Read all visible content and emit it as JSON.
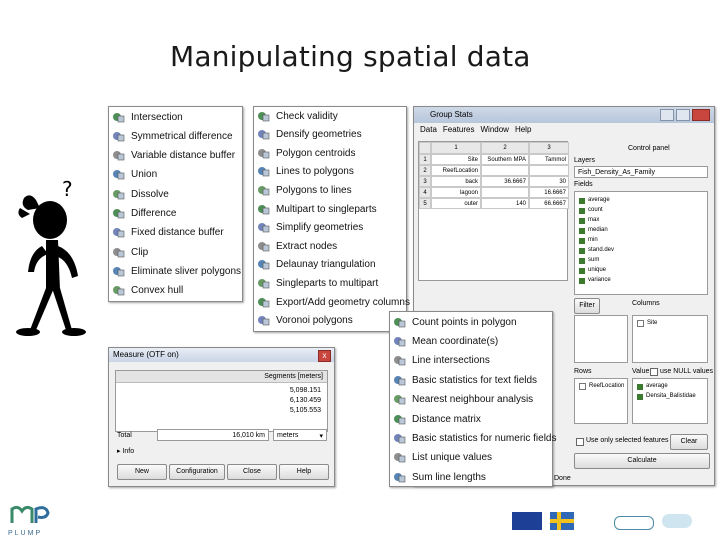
{
  "title": "Manipulating spatial data",
  "menu1": [
    {
      "label": "Intersection",
      "icon": "intersection-icon"
    },
    {
      "label": "Symmetrical difference",
      "icon": "symmetrical-difference-icon"
    },
    {
      "label": "Variable distance buffer",
      "icon": "variable-buffer-icon"
    },
    {
      "label": "Union",
      "icon": "union-icon"
    },
    {
      "label": "Dissolve",
      "icon": "dissolve-icon"
    },
    {
      "label": "Difference",
      "icon": "difference-icon"
    },
    {
      "label": "Fixed distance buffer",
      "icon": "fixed-buffer-icon"
    },
    {
      "label": "Clip",
      "icon": "clip-icon"
    },
    {
      "label": "Eliminate sliver polygons",
      "icon": "eliminate-sliver-icon"
    },
    {
      "label": "Convex hull",
      "icon": "convex-hull-icon"
    }
  ],
  "menu2": [
    {
      "label": "Check validity",
      "icon": "check-validity-icon"
    },
    {
      "label": "Densify geometries",
      "icon": "densify-icon"
    },
    {
      "label": "Polygon centroids",
      "icon": "centroids-icon"
    },
    {
      "label": "Lines to polygons",
      "icon": "lines-to-polygons-icon"
    },
    {
      "label": "Polygons to lines",
      "icon": "polygons-to-lines-icon"
    },
    {
      "label": "Multipart to singleparts",
      "icon": "multipart-icon"
    },
    {
      "label": "Simplify geometries",
      "icon": "simplify-icon"
    },
    {
      "label": "Extract nodes",
      "icon": "extract-nodes-icon"
    },
    {
      "label": "Delaunay triangulation",
      "icon": "delaunay-icon"
    },
    {
      "label": "Singleparts to multipart",
      "icon": "singleparts-icon"
    },
    {
      "label": "Export/Add geometry columns",
      "icon": "export-geometry-icon"
    },
    {
      "label": "Voronoi polygons",
      "icon": "voronoi-icon"
    }
  ],
  "menu3": [
    {
      "label": "Count points in polygon",
      "icon": "count-points-icon"
    },
    {
      "label": "Mean coordinate(s)",
      "icon": "mean-coordinates-icon"
    },
    {
      "label": "Line intersections",
      "icon": "line-intersections-icon"
    },
    {
      "label": "Basic statistics for text fields",
      "icon": "text-stats-icon"
    },
    {
      "label": "Nearest neighbour analysis",
      "icon": "nearest-neighbour-icon"
    },
    {
      "label": "Distance matrix",
      "icon": "distance-matrix-icon"
    },
    {
      "label": "Basic statistics for numeric fields",
      "icon": "numeric-stats-icon"
    },
    {
      "label": "List unique values",
      "icon": "unique-values-icon"
    },
    {
      "label": "Sum line lengths",
      "icon": "sum-lines-icon"
    }
  ],
  "measure": {
    "title": "Measure (OTF on)",
    "close": "x",
    "col_header": "Segments [meters]",
    "segments": [
      "5,098.151",
      "6,130.459",
      "5,105.553"
    ],
    "total_label": "Total",
    "total_value": "16,010 km",
    "unit": "meters",
    "info": "Info",
    "buttons": [
      "New",
      "Configuration",
      "Close",
      "Help"
    ]
  },
  "groupstats": {
    "title": "Group Stats",
    "menus": [
      "Data",
      "Features",
      "Window",
      "Help"
    ],
    "col_headers": [
      "1",
      "2",
      "3"
    ],
    "header_row": [
      "Site",
      "Southern MPA",
      "Tammol"
    ],
    "row_labels": [
      "1",
      "2",
      "3",
      "4",
      "5"
    ],
    "rows": [
      [
        "Site",
        "Southern MPA",
        "Tammol"
      ],
      [
        "ReefLocation",
        "",
        ""
      ],
      [
        "back",
        "36.6667",
        "30"
      ],
      [
        "lagoon",
        "",
        "16.6667"
      ],
      [
        "outer",
        "140",
        "66.6667"
      ]
    ],
    "control_panel": "Control panel",
    "layers_label": "Layers",
    "layer_value": "Fish_Density_As_Family",
    "fields_label": "Fields",
    "fields": [
      "average",
      "count",
      "max",
      "median",
      "min",
      "stand.dev",
      "sum",
      "unique",
      "variance"
    ],
    "filter": "Filter",
    "columns_label": "Columns",
    "columns_item": "Site",
    "rows_label": "Rows",
    "rows_item": "ReefLocation",
    "value_label": "Value",
    "null_label": "use NULL values",
    "value_items": [
      "average",
      "Densita_Balistidae"
    ],
    "only_selected": "Use only selected features",
    "clear": "Clear",
    "calculate": "Calculate",
    "status": "Done"
  },
  "figure_question": "?",
  "logo_text": "PLUMP"
}
